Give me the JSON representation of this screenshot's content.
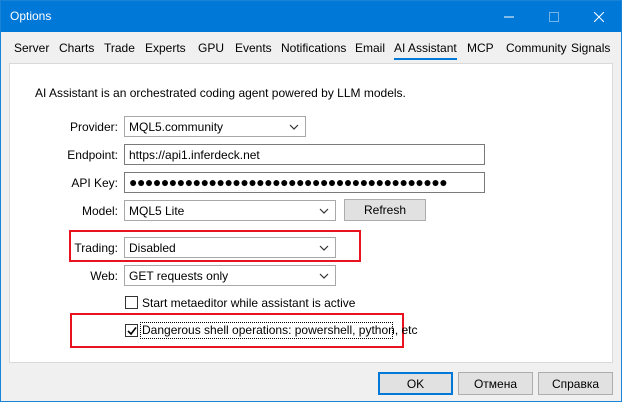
{
  "window": {
    "title": "Options",
    "controls": {
      "minimize": "minimize-icon",
      "maximize": "maximize-icon",
      "close": "close-icon"
    }
  },
  "tabs": [
    {
      "label": "Server"
    },
    {
      "label": "Charts"
    },
    {
      "label": "Trade"
    },
    {
      "label": "Experts"
    },
    {
      "label": "GPU"
    },
    {
      "label": "Events"
    },
    {
      "label": "Notifications"
    },
    {
      "label": "Email"
    },
    {
      "label": "AI Assistant",
      "active": true
    },
    {
      "label": "MCP"
    },
    {
      "label": "Community"
    },
    {
      "label": "Signals"
    }
  ],
  "assistant": {
    "description": "AI Assistant is an orchestrated coding agent powered by LLM models.",
    "provider": {
      "label": "Provider:",
      "value": "MQL5.community"
    },
    "endpoint": {
      "label": "Endpoint:",
      "value": "https://api1.inferdeck.net"
    },
    "api_key": {
      "label": "API Key:",
      "value": "●●●●●●●●●●●●●●●●●●●●●●●●●●●●●●●●●●●●●●●●"
    },
    "model": {
      "label": "Model:",
      "value": "MQL5 Lite",
      "refresh_label": "Refresh"
    },
    "trading": {
      "label": "Trading:",
      "value": "Disabled"
    },
    "web": {
      "label": "Web:",
      "value": "GET requests only"
    },
    "start_metaeditor": {
      "label": "Start metaeditor while assistant is active",
      "checked": false
    },
    "dangerous_shell": {
      "label": "Dangerous shell operations: powershell, python, etc",
      "checked": true
    }
  },
  "footer": {
    "ok_label": "OK",
    "cancel_label": "Отмена",
    "help_label": "Справка"
  },
  "colors": {
    "titlebar": "#0078d7",
    "highlight": "#e8131e",
    "active_tab_underline": "#0078d7"
  }
}
